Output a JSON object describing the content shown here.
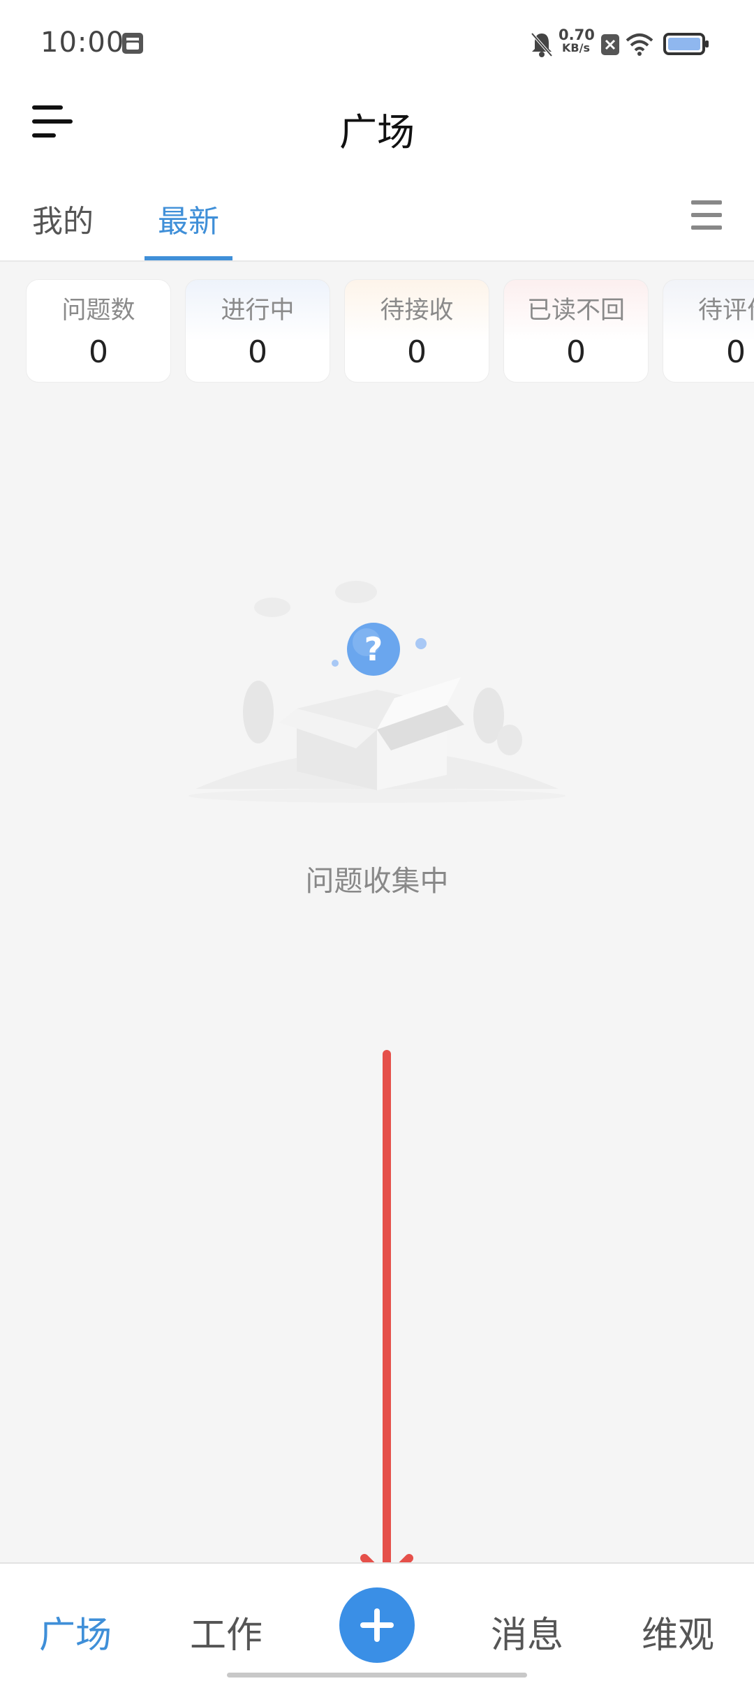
{
  "status_bar": {
    "time": "10:00",
    "net_speed_value": "0.70",
    "net_speed_unit": "KB/s",
    "icons": [
      "storage-icon",
      "mute-bell-icon",
      "close-box-icon",
      "wifi-icon",
      "battery-icon"
    ]
  },
  "header": {
    "title": "广场",
    "menu_icon": "menu-icon"
  },
  "tabs": [
    {
      "label": "我的",
      "active": false
    },
    {
      "label": "最新",
      "active": true
    }
  ],
  "tabs_more_icon": "list-icon",
  "stats": [
    {
      "label": "问题数",
      "value": "0",
      "tint": "#ffffff"
    },
    {
      "label": "进行中",
      "value": "0",
      "tint": "#eef3fb"
    },
    {
      "label": "待接收",
      "value": "0",
      "tint": "#fdf4ea"
    },
    {
      "label": "已读不回",
      "value": "0",
      "tint": "#fcefef"
    },
    {
      "label": "待评价",
      "value": "0",
      "tint": "#f1f3f8"
    }
  ],
  "empty_state": {
    "text": "问题收集中",
    "illustration": "empty-box-question-icon"
  },
  "bottom_nav": {
    "items": [
      {
        "label": "广场",
        "active": true
      },
      {
        "label": "工作",
        "active": false
      },
      {
        "label": "消息",
        "active": false
      },
      {
        "label": "维观",
        "active": false
      }
    ],
    "fab_icon": "plus-icon"
  },
  "colors": {
    "accent": "#3f8fd8",
    "annotation_arrow": "#e5504a",
    "background": "#f5f5f5"
  }
}
